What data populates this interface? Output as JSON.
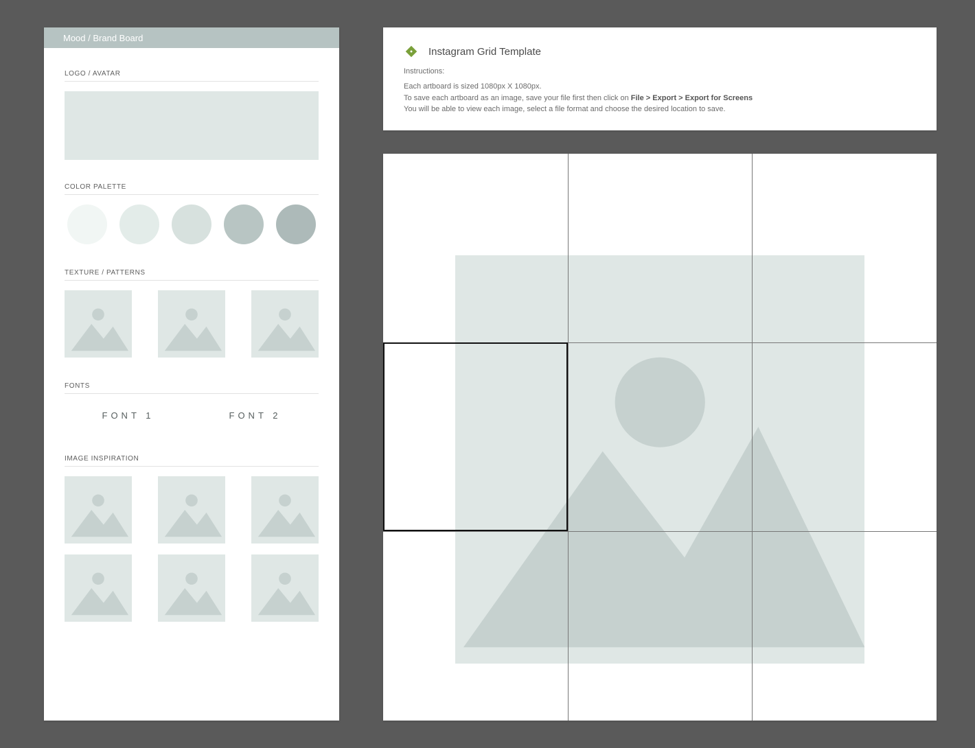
{
  "board": {
    "title": "Mood / Brand Board",
    "sections": {
      "logo": "LOGO / AVATAR",
      "palette": "COLOR PALETTE",
      "texture": "TEXTURE / PATTERNS",
      "fonts": "FONTS",
      "insp": "IMAGE INSPIRATION"
    },
    "palette": [
      "#f1f6f4",
      "#e3ece9",
      "#d7e1de",
      "#b8c5c3",
      "#adbab9"
    ],
    "font_samples": [
      "FONT 1",
      "FONT 2"
    ]
  },
  "header": {
    "title": "Instagram Grid Template",
    "instructions_label": "Instructions:",
    "line1": "Each artboard is sized 1080px X 1080px.",
    "line2_a": "To save each artboard as an image, save your file first then click on ",
    "line2_b": "File > Export > Export for Screens",
    "line3": "You will be able to view each image, select a file format and choose the desired location to save."
  }
}
